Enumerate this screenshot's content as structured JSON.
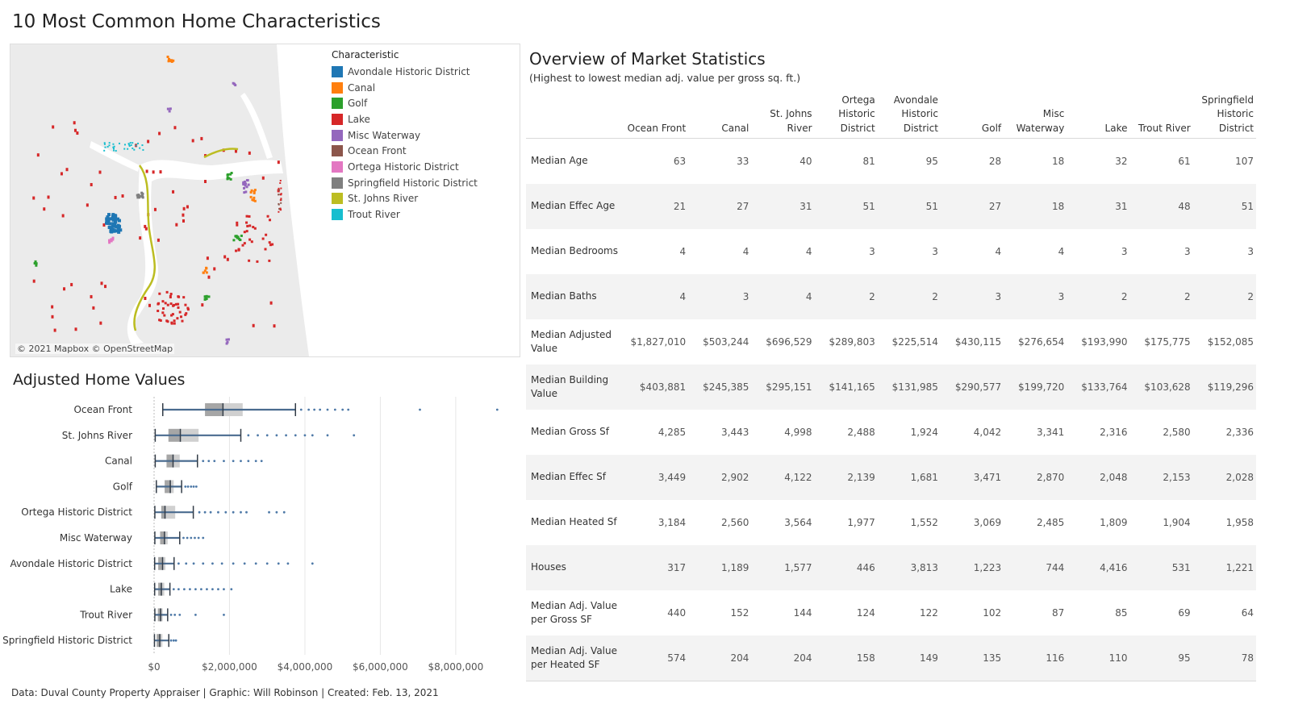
{
  "title": "10 Most Common Home Characteristics",
  "map": {
    "credit": "© 2021 Mapbox © OpenStreetMap",
    "legend_title": "Characteristic",
    "legend": [
      {
        "label": "Avondale Historic District",
        "color": "#1f77b4"
      },
      {
        "label": "Canal",
        "color": "#ff7f0e"
      },
      {
        "label": "Golf",
        "color": "#2ca02c"
      },
      {
        "label": "Lake",
        "color": "#d62728"
      },
      {
        "label": "Misc Waterway",
        "color": "#9467bd"
      },
      {
        "label": "Ocean Front",
        "color": "#8c564b"
      },
      {
        "label": "Ortega Historic District",
        "color": "#e377c2"
      },
      {
        "label": "Springfield Historic District",
        "color": "#7f7f7f"
      },
      {
        "label": "St. Johns River",
        "color": "#bcbd22"
      },
      {
        "label": "Trout River",
        "color": "#17becf"
      }
    ]
  },
  "boxplot_title": "Adjusted Home Values",
  "chart_data": {
    "type": "box",
    "xlim": [
      0,
      9500000
    ],
    "x_ticks": [
      0,
      2000000,
      4000000,
      6000000,
      8000000
    ],
    "x_tick_labels": [
      "$0",
      "$2,000,000",
      "$4,000,000",
      "$6,000,000",
      "$8,000,000"
    ],
    "categories": [
      {
        "name": "Ocean Front",
        "min": 230000,
        "q1": 1350000,
        "median": 1827010,
        "q3": 2350000,
        "max": 3750000,
        "outliers": [
          3900000,
          4100000,
          4250000,
          4400000,
          4600000,
          4800000,
          5000000,
          5150000,
          7050000,
          9100000
        ]
      },
      {
        "name": "St. Johns River",
        "min": 30000,
        "q1": 380000,
        "median": 696529,
        "q3": 1180000,
        "max": 2300000,
        "outliers": [
          2500000,
          2750000,
          3000000,
          3250000,
          3500000,
          3750000,
          4000000,
          4200000,
          4600000,
          5300000
        ]
      },
      {
        "name": "Canal",
        "min": 30000,
        "q1": 330000,
        "median": 503244,
        "q3": 680000,
        "max": 1150000,
        "outliers": [
          1300000,
          1450000,
          1600000,
          1850000,
          2100000,
          2300000,
          2500000,
          2700000,
          2850000
        ]
      },
      {
        "name": "Golf",
        "min": 60000,
        "q1": 280000,
        "median": 430115,
        "q3": 520000,
        "max": 730000,
        "outliers": [
          830000,
          900000,
          980000,
          1050000,
          1120000
        ]
      },
      {
        "name": "Ortega Historic District",
        "min": 20000,
        "q1": 190000,
        "median": 289803,
        "q3": 560000,
        "max": 1040000,
        "outliers": [
          1200000,
          1350000,
          1500000,
          1700000,
          1900000,
          2100000,
          2300000,
          2450000,
          3050000,
          3250000,
          3450000
        ]
      },
      {
        "name": "Misc Waterway",
        "min": 20000,
        "q1": 160000,
        "median": 276654,
        "q3": 360000,
        "max": 680000,
        "outliers": [
          780000,
          880000,
          980000,
          1080000,
          1180000,
          1300000
        ]
      },
      {
        "name": "Avondale Historic District",
        "min": 15000,
        "q1": 110000,
        "median": 225514,
        "q3": 300000,
        "max": 530000,
        "outliers": [
          650000,
          850000,
          1050000,
          1300000,
          1550000,
          1800000,
          2100000,
          2400000,
          2700000,
          3000000,
          3300000,
          3550000,
          4200000
        ]
      },
      {
        "name": "Lake",
        "min": 15000,
        "q1": 110000,
        "median": 193990,
        "q3": 270000,
        "max": 420000,
        "outliers": [
          520000,
          650000,
          800000,
          950000,
          1100000,
          1250000,
          1400000,
          1550000,
          1700000,
          1850000,
          2050000
        ]
      },
      {
        "name": "Trout River",
        "min": 20000,
        "q1": 100000,
        "median": 175775,
        "q3": 230000,
        "max": 360000,
        "outliers": [
          450000,
          550000,
          680000,
          1100000,
          1850000
        ]
      },
      {
        "name": "Springfield Historic District",
        "min": 10000,
        "q1": 70000,
        "median": 152085,
        "q3": 220000,
        "max": 390000,
        "outliers": [
          450000,
          520000,
          580000
        ]
      }
    ]
  },
  "footer": "Data: Duval County Property Appraiser  |  Graphic: Will Robinson  |  Created: Feb. 13, 2021",
  "table": {
    "title": "Overview of Market Statistics",
    "subtitle": "(Highest to lowest median adj. value per gross sq. ft.)",
    "columns": [
      "Ocean Front",
      "Canal",
      "St. Johns River",
      "Ortega Historic District",
      "Avondale Historic District",
      "Golf",
      "Misc Waterway",
      "Lake",
      "Trout River",
      "Springfield Historic District"
    ],
    "rows": [
      {
        "label": "Median Age",
        "values": [
          "63",
          "33",
          "40",
          "81",
          "95",
          "28",
          "18",
          "32",
          "61",
          "107"
        ]
      },
      {
        "label": "Median Effec Age",
        "values": [
          "21",
          "27",
          "31",
          "51",
          "51",
          "27",
          "18",
          "31",
          "48",
          "51"
        ]
      },
      {
        "label": "Median Bedrooms",
        "values": [
          "4",
          "4",
          "4",
          "3",
          "3",
          "4",
          "4",
          "3",
          "3",
          "3"
        ]
      },
      {
        "label": "Median Baths",
        "values": [
          "4",
          "3",
          "4",
          "2",
          "2",
          "3",
          "3",
          "2",
          "2",
          "2"
        ]
      },
      {
        "label": "Median Adjusted Value",
        "values": [
          "$1,827,010",
          "$503,244",
          "$696,529",
          "$289,803",
          "$225,514",
          "$430,115",
          "$276,654",
          "$193,990",
          "$175,775",
          "$152,085"
        ]
      },
      {
        "label": "Median Building Value",
        "values": [
          "$403,881",
          "$245,385",
          "$295,151",
          "$141,165",
          "$131,985",
          "$290,577",
          "$199,720",
          "$133,764",
          "$103,628",
          "$119,296"
        ]
      },
      {
        "label": "Median Gross Sf",
        "values": [
          "4,285",
          "3,443",
          "4,998",
          "2,488",
          "1,924",
          "4,042",
          "3,341",
          "2,316",
          "2,580",
          "2,336"
        ]
      },
      {
        "label": "Median Effec Sf",
        "values": [
          "3,449",
          "2,902",
          "4,122",
          "2,139",
          "1,681",
          "3,471",
          "2,870",
          "2,048",
          "2,153",
          "2,028"
        ]
      },
      {
        "label": "Median Heated Sf",
        "values": [
          "3,184",
          "2,560",
          "3,564",
          "1,977",
          "1,552",
          "3,069",
          "2,485",
          "1,809",
          "1,904",
          "1,958"
        ]
      },
      {
        "label": "Houses",
        "values": [
          "317",
          "1,189",
          "1,577",
          "446",
          "3,813",
          "1,223",
          "744",
          "4,416",
          "531",
          "1,221"
        ]
      },
      {
        "label": "Median Adj. Value per Gross SF",
        "values": [
          "440",
          "152",
          "144",
          "124",
          "122",
          "102",
          "87",
          "85",
          "69",
          "64"
        ]
      },
      {
        "label": "Median Adj. Value per Heated SF",
        "values": [
          "574",
          "204",
          "204",
          "158",
          "149",
          "135",
          "116",
          "110",
          "95",
          "78"
        ]
      }
    ]
  }
}
